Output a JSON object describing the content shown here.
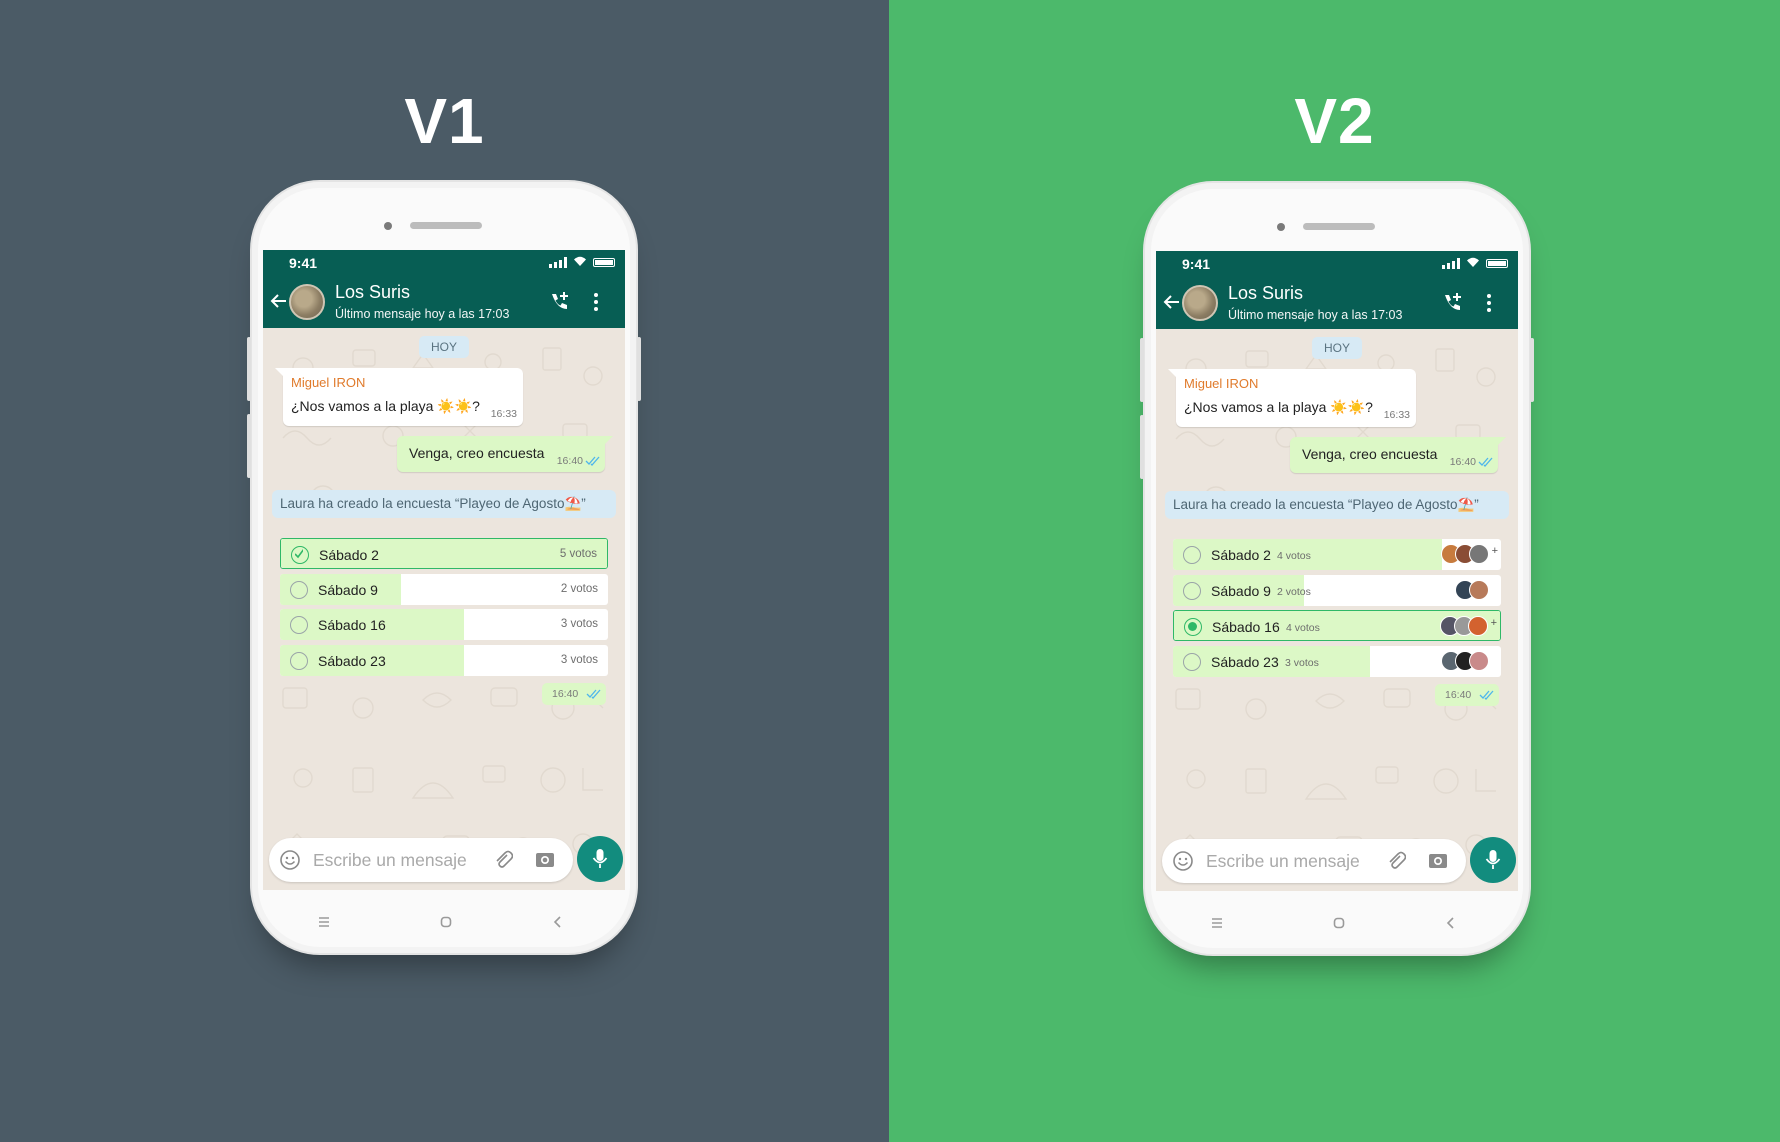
{
  "colors": {
    "v1_background": "#4b5b66",
    "v2_background": "#4cb96b",
    "header": "#075e54",
    "mic_button": "#128c7e",
    "bubble_out": "#dcf8c6",
    "poll_accent": "#2fb867",
    "sender_name": "#e07b2c"
  },
  "versions": [
    {
      "title": "V1",
      "status": {
        "time": "9:41",
        "icons": [
          "signal-icon",
          "wifi-icon",
          "battery-icon"
        ]
      },
      "chat": {
        "name": "Los Suris",
        "subtitle": "Último mensaje hoy a las 17:03"
      },
      "date_chip": "HOY",
      "messages": [
        {
          "sender": "Miguel IRON",
          "text": "¿Nos vamos a la playa ☀️☀️?",
          "time": "16:33"
        },
        {
          "text": "Venga, creo encuesta",
          "time": "16:40",
          "status": "read"
        }
      ],
      "system_message": "Laura ha creado la encuesta “Playeo de Agosto⛱️”",
      "poll": {
        "options": [
          {
            "label": "Sábado 2",
            "votes_text": "5 votos",
            "votes": 5,
            "selected": true
          },
          {
            "label": "Sábado 9",
            "votes_text": "2 votos",
            "votes": 2,
            "selected": false
          },
          {
            "label": "Sábado 16",
            "votes_text": "3 votos",
            "votes": 3,
            "selected": false
          },
          {
            "label": "Sábado 23",
            "votes_text": "3 votos",
            "votes": 3,
            "selected": false
          }
        ],
        "time": "16:40"
      },
      "input": {
        "placeholder": "Escribe un mensaje"
      }
    },
    {
      "title": "V2",
      "status": {
        "time": "9:41",
        "icons": [
          "signal-icon",
          "wifi-icon",
          "battery-icon"
        ]
      },
      "chat": {
        "name": "Los Suris",
        "subtitle": "Último mensaje hoy a las 17:03"
      },
      "date_chip": "HOY",
      "messages": [
        {
          "sender": "Miguel IRON",
          "text": "¿Nos vamos a la playa ☀️☀️?",
          "time": "16:33"
        },
        {
          "text": "Venga, creo encuesta",
          "time": "16:40",
          "status": "read"
        }
      ],
      "system_message": "Laura ha creado la encuesta “Playeo de Agosto⛱️”",
      "poll": {
        "options": [
          {
            "label": "Sábado 2",
            "votes_text": "4 votos",
            "votes": 4,
            "selected": false,
            "voter_count_shown": 3,
            "more": "+"
          },
          {
            "label": "Sábado 9",
            "votes_text": "2 votos",
            "votes": 2,
            "selected": false,
            "voter_count_shown": 2,
            "more": ""
          },
          {
            "label": "Sábado 16",
            "votes_text": "4 votos",
            "votes": 4,
            "selected": true,
            "voter_count_shown": 3,
            "more": "+"
          },
          {
            "label": "Sábado 23",
            "votes_text": "3 votos",
            "votes": 3,
            "selected": false,
            "voter_count_shown": 3,
            "more": ""
          }
        ],
        "time": "16:40"
      },
      "input": {
        "placeholder": "Escribe un mensaje"
      }
    }
  ]
}
